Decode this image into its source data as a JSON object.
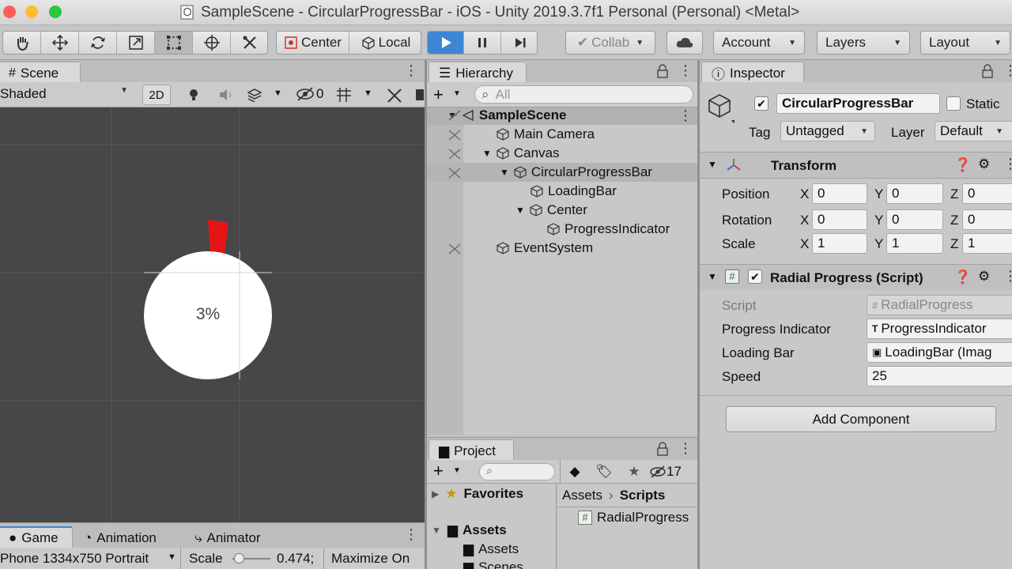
{
  "window": {
    "title": "SampleScene - CircularProgressBar - iOS - Unity 2019.3.7f1 Personal (Personal) <Metal>",
    "colors": {
      "close": "#fe5f57",
      "minimize": "#febc2e",
      "zoom": "#28c840",
      "accent_play": "#3d86d6",
      "scene_bg": "#474747",
      "red_marker": "#e51515"
    }
  },
  "toolbar": {
    "tools": [
      "hand-icon",
      "move-icon",
      "rotate-icon",
      "scale-icon",
      "rect-icon",
      "transform-icon",
      "custom-tool-icon"
    ],
    "pivot": "Center",
    "space": "Local",
    "collab": "Collab",
    "account": "Account",
    "layers": "Layers",
    "layout": "Layout"
  },
  "scene": {
    "tab": "Scene",
    "shading": "Shaded",
    "mode2d": "2D",
    "hidden_count": "0",
    "progress_text": "3%",
    "progress_value": 0.03
  },
  "game": {
    "tabs": [
      "Game",
      "Animation",
      "Animator"
    ],
    "resolution": "Phone 1334x750 Portrait",
    "scale_label": "Scale",
    "scale_value": "0.474;",
    "maximize": "Maximize On"
  },
  "hierarchy": {
    "tab": "Hierarchy",
    "search_placeholder": "All",
    "items": [
      {
        "label": "SampleScene"
      },
      {
        "label": "Main Camera"
      },
      {
        "label": "Canvas"
      },
      {
        "label": "CircularProgressBar"
      },
      {
        "label": "LoadingBar"
      },
      {
        "label": "Center"
      },
      {
        "label": "ProgressIndicator"
      },
      {
        "label": "EventSystem"
      }
    ]
  },
  "project": {
    "tab": "Project",
    "hidden_count": "17",
    "tree": {
      "favorites": "Favorites",
      "assets": "Assets",
      "sub": [
        "Assets",
        "Scenes"
      ]
    },
    "breadcrumb": [
      "Assets",
      "Scripts"
    ],
    "files": [
      "RadialProgress"
    ]
  },
  "inspector": {
    "tab": "Inspector",
    "object_name": "CircularProgressBar",
    "static_label": "Static",
    "tag_label": "Tag",
    "tag_value": "Untagged",
    "layer_label": "Layer",
    "layer_value": "Default",
    "transform": {
      "title": "Transform",
      "rows": [
        {
          "label": "Position",
          "x": "0",
          "y": "0",
          "z": "0"
        },
        {
          "label": "Rotation",
          "x": "0",
          "y": "0",
          "z": "0"
        },
        {
          "label": "Scale",
          "x": "1",
          "y": "1",
          "z": "1"
        }
      ],
      "axes": [
        "X",
        "Y",
        "Z"
      ]
    },
    "script": {
      "title": "Radial Progress (Script)",
      "rows": [
        {
          "label": "Script",
          "value": "RadialProgress"
        },
        {
          "label": "Progress Indicator",
          "value": "ProgressIndicator"
        },
        {
          "label": "Loading Bar",
          "value": "LoadingBar (Imag"
        },
        {
          "label": "Speed",
          "value": "25"
        }
      ]
    },
    "add_component": "Add Component"
  }
}
